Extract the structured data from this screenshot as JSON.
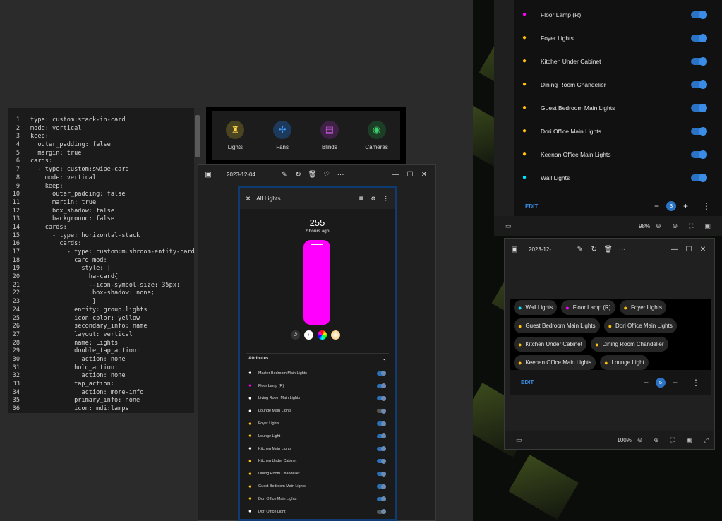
{
  "editor": {
    "lines": [
      {
        "n": "1",
        "t": "type: custom:stack-in-card"
      },
      {
        "n": "2",
        "t": "mode: vertical"
      },
      {
        "n": "3",
        "t": "keep:"
      },
      {
        "n": "4",
        "t": "  outer_padding: false"
      },
      {
        "n": "5",
        "t": "  margin: true"
      },
      {
        "n": "6",
        "t": "cards:"
      },
      {
        "n": "7",
        "t": "  - type: custom:swipe-card"
      },
      {
        "n": "8",
        "t": "    mode: vertical"
      },
      {
        "n": "9",
        "t": "    keep:"
      },
      {
        "n": "10",
        "t": "      outer_padding: false"
      },
      {
        "n": "11",
        "t": "      margin: true"
      },
      {
        "n": "12",
        "t": "      box_shadow: false"
      },
      {
        "n": "13",
        "t": "      background: false"
      },
      {
        "n": "14",
        "t": "    cards:"
      },
      {
        "n": "15",
        "t": "      - type: horizontal-stack"
      },
      {
        "n": "16",
        "t": "        cards:"
      },
      {
        "n": "17",
        "t": "          - type: custom:mushroom-entity-card"
      },
      {
        "n": "18",
        "t": "            card_mod:"
      },
      {
        "n": "19",
        "t": "              style: |"
      },
      {
        "n": "20",
        "t": "                ha-card{"
      },
      {
        "n": "21",
        "t": "                --icon-symbol-size: 35px;"
      },
      {
        "n": "22",
        "t": "                 box-shadow: none;"
      },
      {
        "n": "23",
        "t": "                 }"
      },
      {
        "n": "24",
        "t": "            entity: group.lights"
      },
      {
        "n": "25",
        "t": "            icon_color: yellow"
      },
      {
        "n": "26",
        "t": "            secondary_info: name"
      },
      {
        "n": "27",
        "t": "            layout: vertical"
      },
      {
        "n": "28",
        "t": "            name: Lights"
      },
      {
        "n": "29",
        "t": "            double_tap_action:"
      },
      {
        "n": "30",
        "t": "              action: none"
      },
      {
        "n": "31",
        "t": "            hold_action:"
      },
      {
        "n": "32",
        "t": "              action: none"
      },
      {
        "n": "33",
        "t": "            tap_action:"
      },
      {
        "n": "34",
        "t": "              action: more-info"
      },
      {
        "n": "35",
        "t": "            primary_info: none"
      },
      {
        "n": "36",
        "t": "            icon: mdi:lamps"
      }
    ]
  },
  "shortcuts": [
    {
      "label": "Lights",
      "icon": "lamp-icon",
      "glyph": "♜",
      "bg": "#4a4420",
      "fg": "#ffd54a"
    },
    {
      "label": "Fans",
      "icon": "fan-icon",
      "glyph": "✢",
      "bg": "#1d3a5c",
      "fg": "#3d9bff"
    },
    {
      "label": "Blinds",
      "icon": "blinds-icon",
      "glyph": "▤",
      "bg": "#3e2145",
      "fg": "#c45ad9"
    },
    {
      "label": "Cameras",
      "icon": "camera-icon",
      "glyph": "◉",
      "bg": "#1c3d26",
      "fg": "#3ecf6a"
    }
  ],
  "viewer1": {
    "title": "2023-12-04...",
    "header": "All Lights",
    "value": "255",
    "ago": "2 hours ago",
    "attributes": "Attributes",
    "items": [
      {
        "name": "Master Bedroom Main Lights",
        "color": "#ffffff",
        "on": true
      },
      {
        "name": "Floor Lamp (R)",
        "color": "#ff00ff",
        "on": true
      },
      {
        "name": "Living Room Main Lights",
        "color": "#ffffff",
        "on": true
      },
      {
        "name": "Lounge Main Lights",
        "color": "#ffffff",
        "on": false
      },
      {
        "name": "Foyer Lights",
        "color": "#ffc107",
        "on": true
      },
      {
        "name": "Lounge Light",
        "color": "#ffc107",
        "on": true
      },
      {
        "name": "Kitchen Main Lights",
        "color": "#ffffff",
        "on": true
      },
      {
        "name": "Kitchen Under Cabinet",
        "color": "#ffc107",
        "on": true
      },
      {
        "name": "Dining Room Chandelier",
        "color": "#ffc107",
        "on": true
      },
      {
        "name": "Guest Bedroom Main Lights",
        "color": "#ffc107",
        "on": true
      },
      {
        "name": "Dori Office Main Lights",
        "color": "#ffc107",
        "on": true
      },
      {
        "name": "Dori Office Light",
        "color": "#ffffff",
        "on": false
      }
    ]
  },
  "listwin": {
    "items": [
      {
        "name": "Floor Lamp (R)",
        "color": "#ff00ff"
      },
      {
        "name": "Foyer Lights",
        "color": "#ffc107"
      },
      {
        "name": "Kitchen Under Cabinet",
        "color": "#ffc107"
      },
      {
        "name": "Dining Room Chandelier",
        "color": "#ffc107"
      },
      {
        "name": "Guest Bedroom Main Lights",
        "color": "#ffc107"
      },
      {
        "name": "Dori Office Main Lights",
        "color": "#ffc107"
      },
      {
        "name": "Keenan Office Main Lights",
        "color": "#ffc107"
      },
      {
        "name": "Wall Lights",
        "color": "#00e5ff"
      }
    ],
    "edit": "EDIT",
    "page": "3",
    "zoom": "98%"
  },
  "viewer2": {
    "title": "2023-12-...",
    "chips": [
      {
        "name": "Wall Lights",
        "color": "#00e5ff"
      },
      {
        "name": "Floor Lamp (R)",
        "color": "#ff00ff"
      },
      {
        "name": "Foyer Lights",
        "color": "#ffc107"
      },
      {
        "name": "Guest Bedroom Main Lights",
        "color": "#ffc107"
      },
      {
        "name": "Dori Office Main Lights",
        "color": "#ffc107"
      },
      {
        "name": "Kitchen Under Cabinet",
        "color": "#ffc107"
      },
      {
        "name": "Dining Room Chandelier",
        "color": "#ffc107"
      },
      {
        "name": "Keenan Office Main Lights",
        "color": "#ffc107"
      },
      {
        "name": "Lounge Light",
        "color": "#ffc107"
      }
    ],
    "edit": "EDIT",
    "page": "5",
    "zoom": "100%"
  }
}
